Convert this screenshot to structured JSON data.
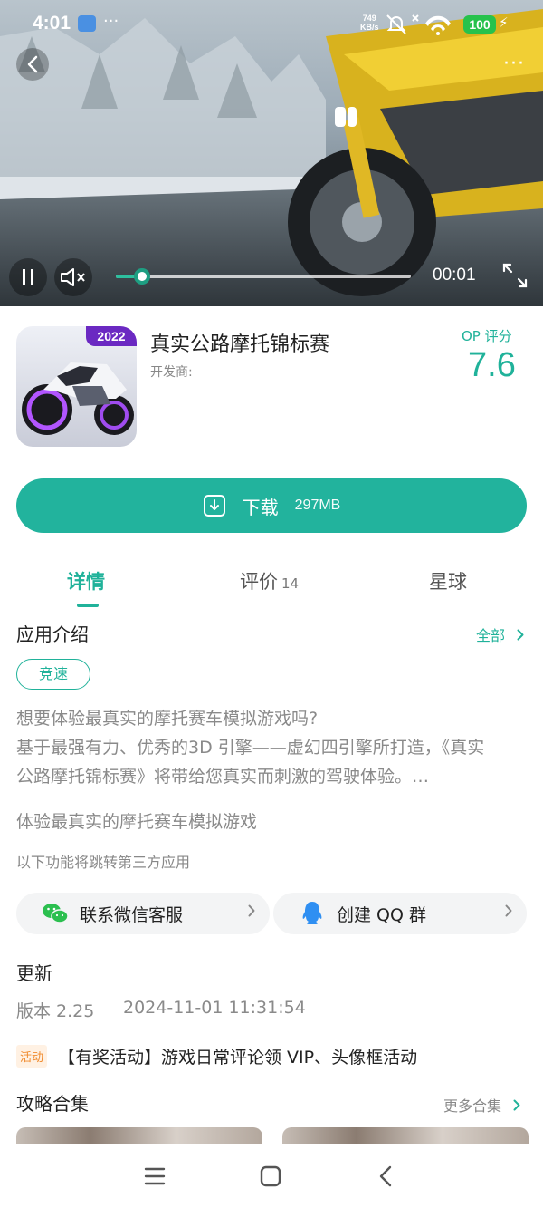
{
  "status_bar": {
    "time": "4:01",
    "dots": "···",
    "net_speed_value": "749",
    "net_speed_unit": "KB/s",
    "battery": "100"
  },
  "video": {
    "current_time": "00:01",
    "progress": 0.09
  },
  "app": {
    "title": "真实公路摩托锦标赛",
    "developer_label": "开发商:",
    "icon_badge": "2022",
    "score_label": "OP 评分",
    "score_value": "7.6"
  },
  "download": {
    "label": "下载",
    "size": "297MB"
  },
  "tabs": [
    {
      "label": "详情",
      "count": ""
    },
    {
      "label": "评价",
      "count": "14"
    },
    {
      "label": "星球",
      "count": ""
    }
  ],
  "intro": {
    "title": "应用介绍",
    "more": "全部",
    "tag": "竞速",
    "description_lines": [
      "想要体验最真实的摩托赛车模拟游戏吗?",
      "基于最强有力、优秀的3D 引擎——虚幻四引擎所打造，《真实",
      "公路摩托锦标赛》将带给您真实而刺激的驾驶体验。…"
    ],
    "summary": "体验最真实的摩托赛车模拟游戏",
    "third_party_note": "以下功能将跳转第三方应用"
  },
  "actions": {
    "wechat": "联系微信客服",
    "qq": "创建 QQ 群"
  },
  "update": {
    "title": "更新",
    "version": "版本 2.25",
    "date": "2024-11-01 11:31:54"
  },
  "event": {
    "badge": "活动",
    "text": "【有奖活动】游戏日常评论领 VIP、头像框活动"
  },
  "guides": {
    "title": "攻略合集",
    "more": "更多合集"
  },
  "colors": {
    "accent": "#20b29a",
    "download_bg": "#22b39d",
    "event_badge": "#f08a2c"
  }
}
